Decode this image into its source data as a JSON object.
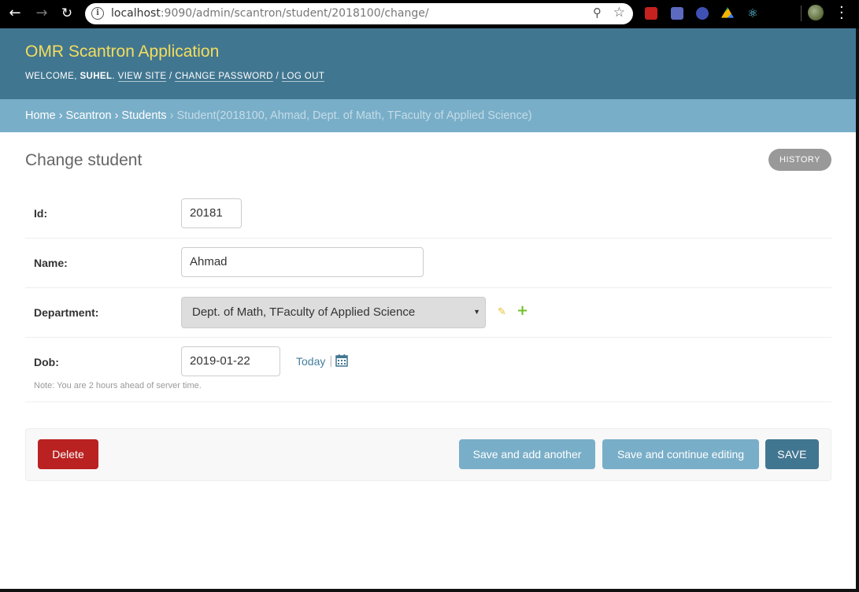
{
  "browser": {
    "url_host": "localhost",
    "url_path": ":9090/admin/scantron/student/2018100/change/",
    "info_icon": "info-icon",
    "zoom_icon": "zoom-icon",
    "star_icon": "star-icon"
  },
  "header": {
    "site_name": "OMR Scantron Application",
    "welcome": "WELCOME,",
    "username": "SUHEL",
    "view_site": "VIEW SITE",
    "sep1": "/",
    "change_password": "CHANGE PASSWORD",
    "sep2": "/",
    "log_out": "LOG OUT"
  },
  "breadcrumbs": {
    "items": [
      "Home",
      "Scantron",
      "Students"
    ],
    "current": "Student(2018100, Ahmad, Dept. of Math, TFaculty of Applied Science)",
    "separator": "›"
  },
  "content": {
    "title": "Change student",
    "history": "HISTORY"
  },
  "form": {
    "id": {
      "label": "Id:",
      "value": "20181"
    },
    "name": {
      "label": "Name:",
      "value": "Ahmad"
    },
    "department": {
      "label": "Department:",
      "value": "Dept. of Math, TFaculty of Applied Science"
    },
    "dob": {
      "label": "Dob:",
      "value": "2019-01-22",
      "today": "Today",
      "today_sep": "|",
      "note": "Note: You are 2 hours ahead of server time."
    }
  },
  "actions": {
    "delete": "Delete",
    "save_add_another": "Save and add another",
    "save_continue": "Save and continue editing",
    "save": "SAVE"
  },
  "colors": {
    "header_bg": "#417690",
    "site_name": "#f5dd5d",
    "breadcrumbs_bg": "#79aec8",
    "delete": "#ba2121",
    "save": "#417690"
  }
}
